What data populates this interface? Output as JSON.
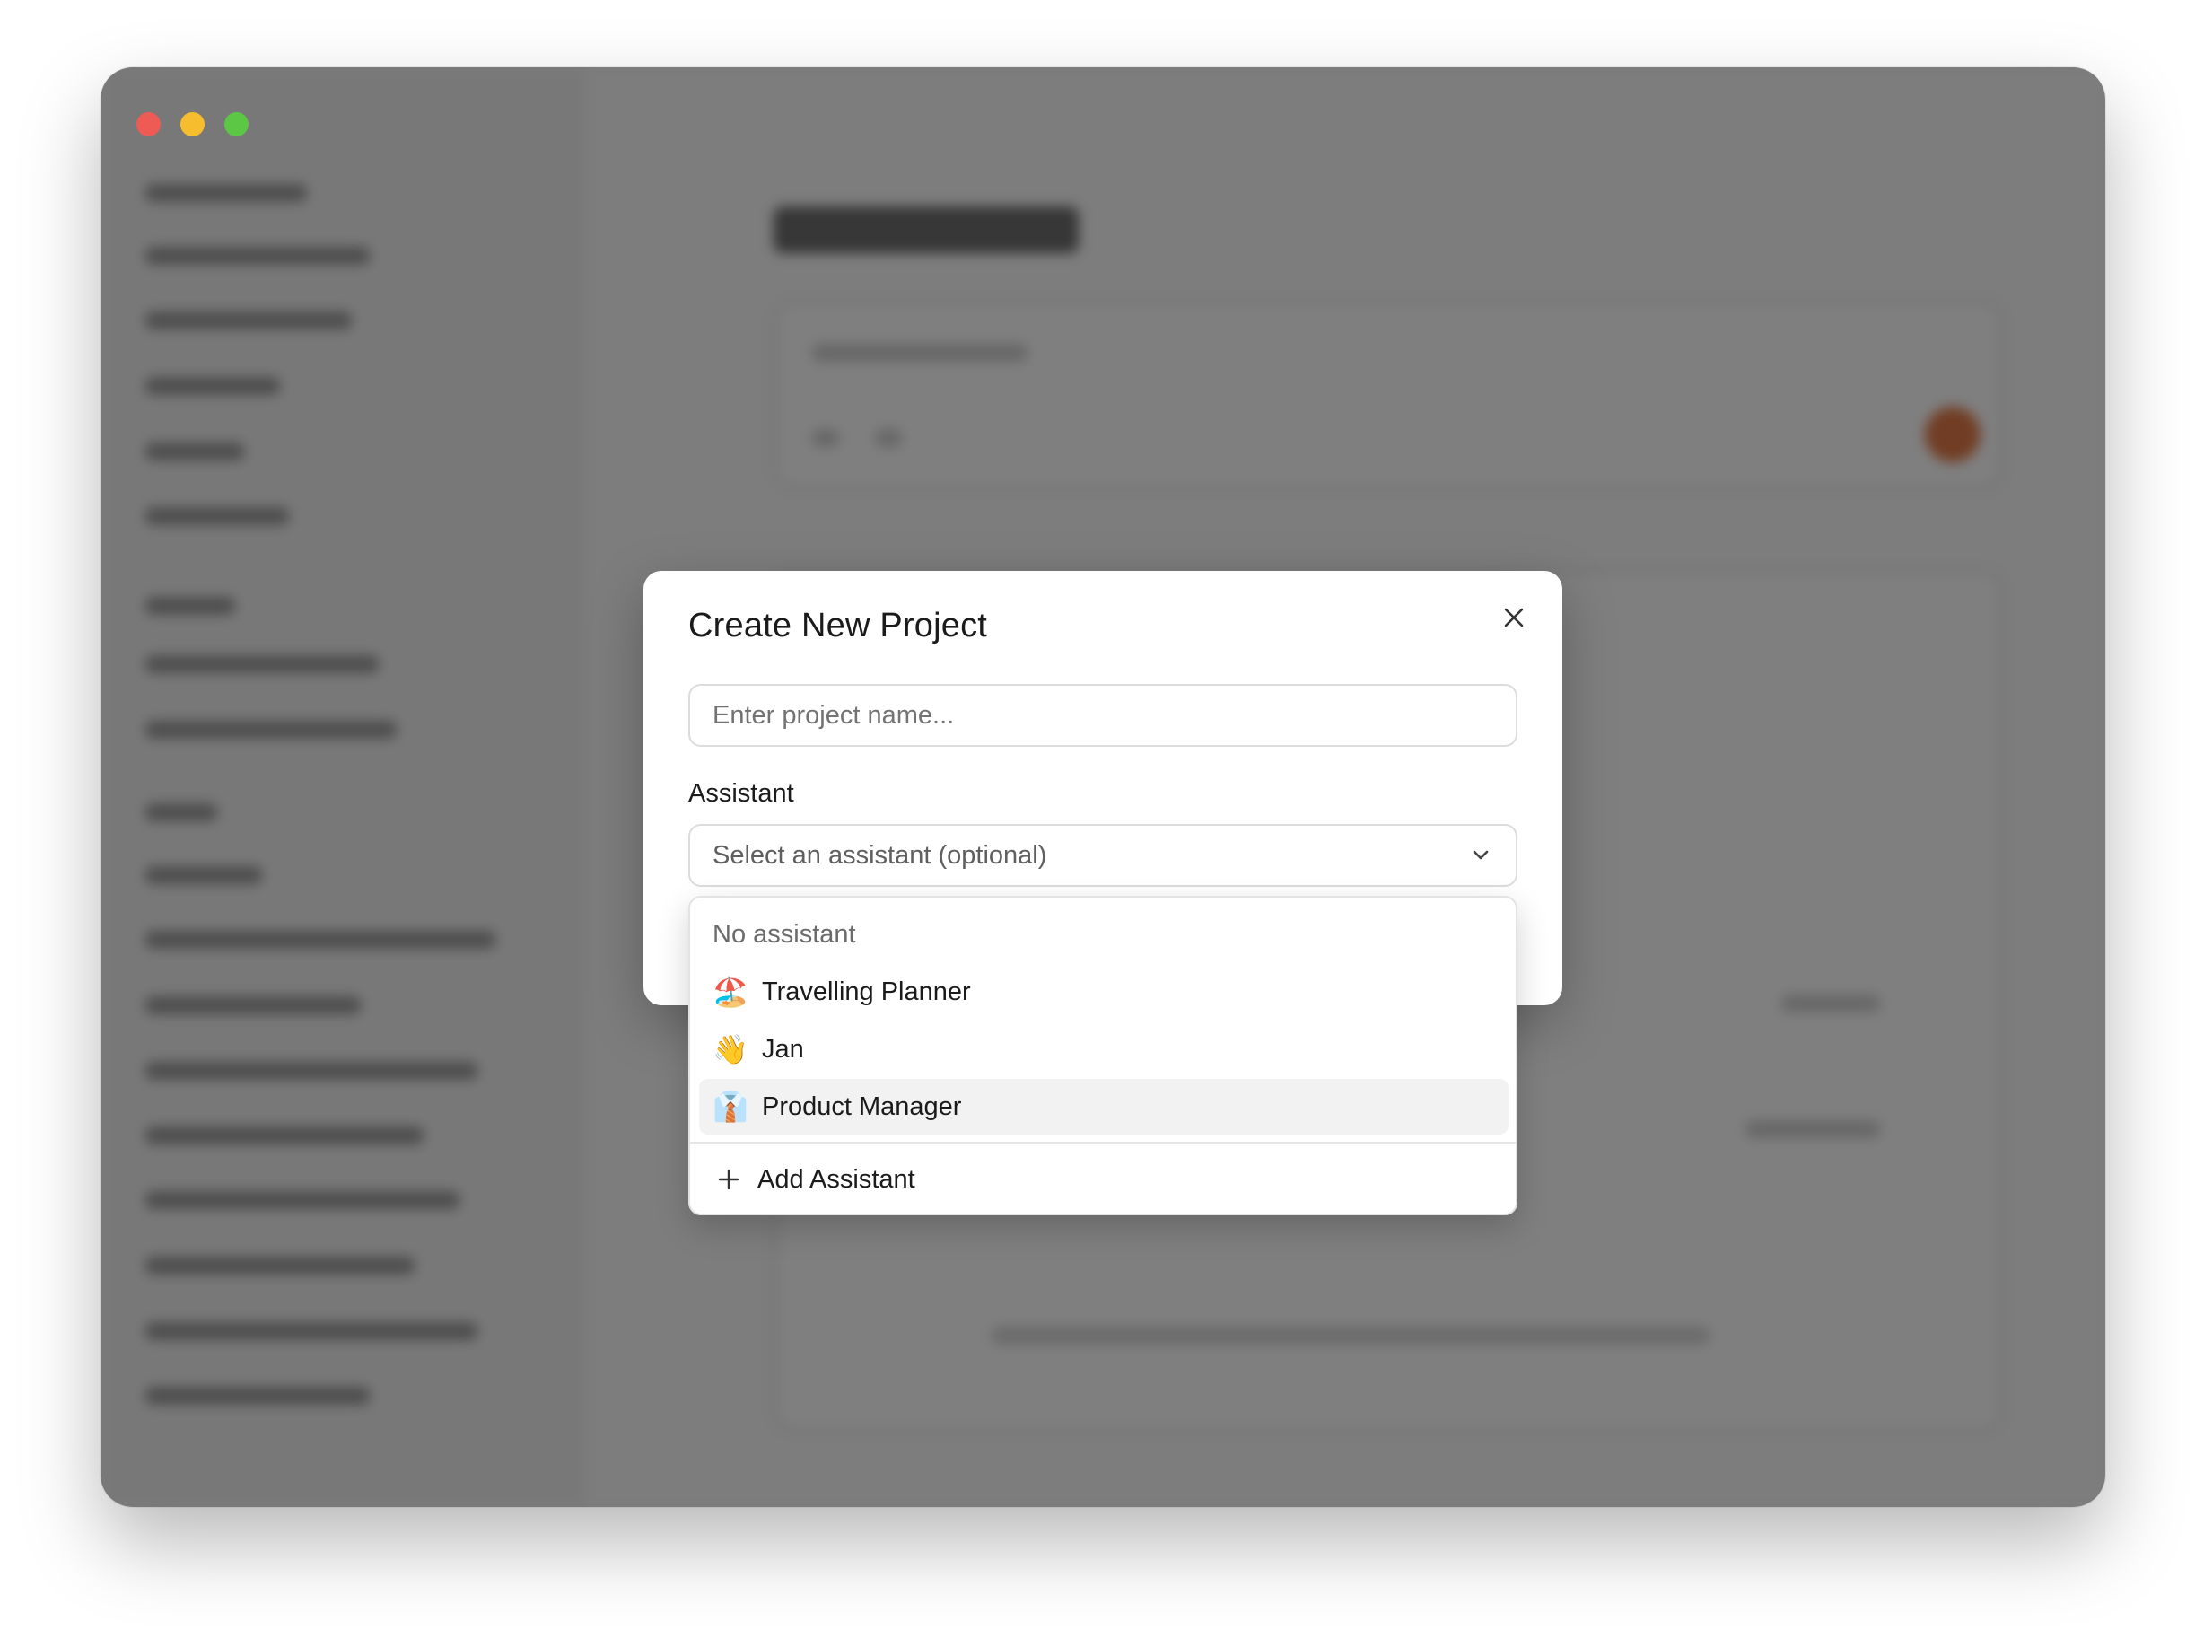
{
  "window": {
    "controls": {
      "close_color": "#ee5b54",
      "minimize_color": "#f6bd2f",
      "maximize_color": "#5bc744"
    }
  },
  "dialog": {
    "title": "Create New Project",
    "close_icon": "close-icon",
    "name_input": {
      "placeholder": "Enter project name...",
      "value": ""
    },
    "assistant_label": "Assistant",
    "assistant_select": {
      "placeholder": "Select an assistant (optional)",
      "icon": "chevron-down-icon"
    }
  },
  "dropdown": {
    "none_option": "No assistant",
    "options": [
      {
        "emoji": "🏖️",
        "label": "Travelling Planner"
      },
      {
        "emoji": "👋",
        "label": "Jan"
      },
      {
        "emoji": "👔",
        "label": "Product Manager"
      }
    ],
    "highlighted_option": "Product Manager",
    "add_label": "Add Assistant",
    "add_icon": "plus-icon"
  }
}
